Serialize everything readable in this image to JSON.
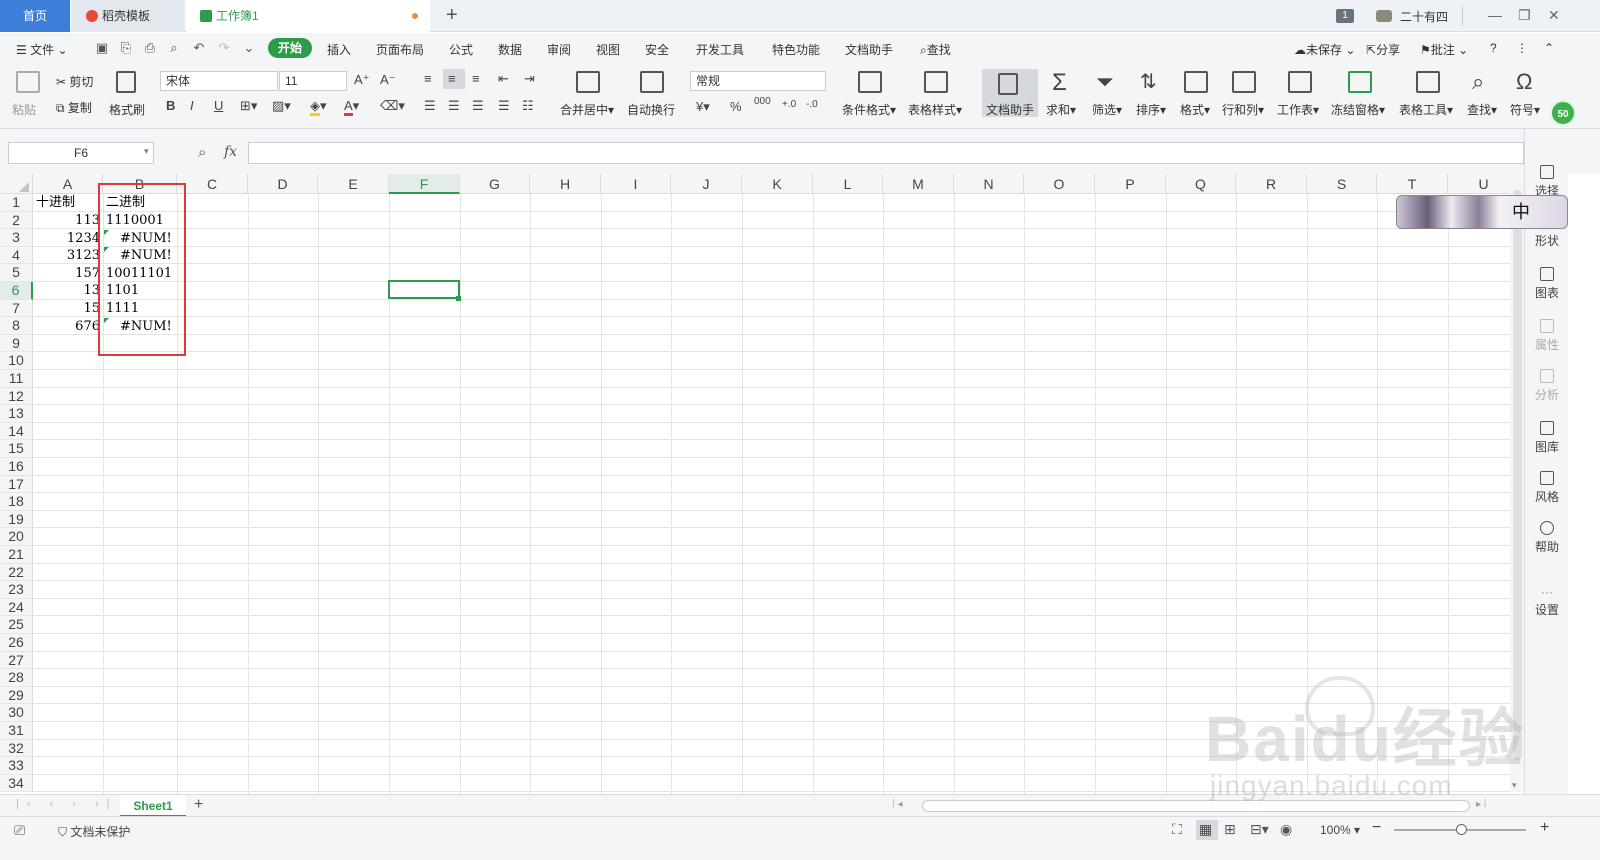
{
  "tabs": {
    "home": "首页",
    "template": "稻壳模板",
    "workbook": "工作簿1",
    "new_tab": "+",
    "window_count": "1",
    "user": "二十有四"
  },
  "menu": {
    "file": "文件",
    "items": [
      "开始",
      "插入",
      "页面布局",
      "公式",
      "数据",
      "审阅",
      "视图",
      "安全",
      "开发工具",
      "特色功能",
      "文档助手"
    ],
    "search": "查找",
    "unsaved": "未保存",
    "share": "分享",
    "comment": "批注"
  },
  "ribbon": {
    "paste": "粘贴",
    "cut": "剪切",
    "copy": "复制",
    "format_painter": "格式刷",
    "font_name": "宋体",
    "font_size": "11",
    "bold": "B",
    "italic": "I",
    "underline": "U",
    "merge_center": "合并居中",
    "wrap_text": "自动换行",
    "number_format": "常规",
    "percent": "%",
    "thousands": "000",
    "cond_format": "条件格式",
    "table_style": "表格样式",
    "doc_assistant": "文档助手",
    "sum": "求和",
    "filter": "筛选",
    "sort": "排序",
    "format": "格式",
    "row_col": "行和列",
    "worksheet": "工作表",
    "freeze": "冻结窗格",
    "table_tools": "表格工具",
    "find": "查找",
    "symbol": "符号"
  },
  "formula_bar": {
    "name_box": "F6",
    "fx": "fx",
    "value": ""
  },
  "grid": {
    "columns": [
      "A",
      "B",
      "C",
      "D",
      "E",
      "F",
      "G",
      "H",
      "I",
      "J",
      "K",
      "L",
      "M",
      "N",
      "O",
      "P",
      "Q",
      "R",
      "S",
      "T",
      "U"
    ],
    "active_column": "F",
    "active_row": "6",
    "rows": [
      "1",
      "2",
      "3",
      "4",
      "5",
      "6",
      "7",
      "8",
      "9",
      "10",
      "11",
      "12",
      "13",
      "14",
      "15",
      "16",
      "17",
      "18",
      "19",
      "20",
      "21",
      "22",
      "23",
      "24",
      "25",
      "26",
      "27",
      "28",
      "29",
      "30",
      "31",
      "32",
      "33",
      "34"
    ],
    "cells": {
      "A1": "十进制",
      "B1": "二进制",
      "A2": "113",
      "B2": "1110001",
      "A3": "1234",
      "B3": "#NUM!",
      "A4": "3123",
      "B4": "#NUM!",
      "A5": "157",
      "B5": "10011101",
      "A6": "13",
      "B6": "1101",
      "A7": "15",
      "B7": "1111",
      "A8": "676",
      "B8": "#NUM!"
    }
  },
  "sheets": {
    "active": "Sheet1",
    "add": "+"
  },
  "status": {
    "protect": "文档未保护",
    "zoom": "100%"
  },
  "right_panel": {
    "items": [
      "选择",
      "形状",
      "图表",
      "属性",
      "分析",
      "图库",
      "风格",
      "帮助",
      "设置"
    ]
  },
  "badge": "50",
  "ime": "中",
  "watermark": {
    "main": "Baidu经验",
    "sub": "jingyan.baidu.com"
  },
  "colors": {
    "accent_green": "#2c9c4a",
    "tab_blue": "#3d7ed8",
    "annotation_red": "#e0393b"
  }
}
